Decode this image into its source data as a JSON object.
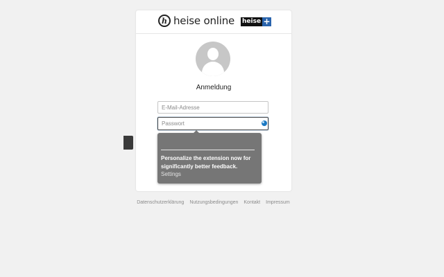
{
  "header": {
    "logo_glyph": "h",
    "logo_text": "heise online",
    "plus_badge_word": "heise",
    "plus_badge_sign": "+"
  },
  "login": {
    "title": "Anmeldung",
    "email_placeholder": "E-Mail-Adresse",
    "email_value": "",
    "password_placeholder": "Passwort",
    "password_value": ""
  },
  "tooltip": {
    "message": "Personalize the extension now for significantly better feedback.",
    "settings_link": "Settings"
  },
  "footer": {
    "links": [
      "Datenschutzerklärung",
      "Nutzungsbedingungen",
      "Kontakt",
      "Impressum"
    ]
  },
  "colors": {
    "background": "#f1f1f1",
    "card": "#ffffff",
    "badge_blue": "#2a64ad",
    "tooltip_bg": "#767676",
    "extension_icon": "#1a78c2"
  },
  "icons": {
    "logo": "heise-logo-icon",
    "avatar": "user-avatar-icon",
    "password_extension": "password-manager-icon"
  }
}
